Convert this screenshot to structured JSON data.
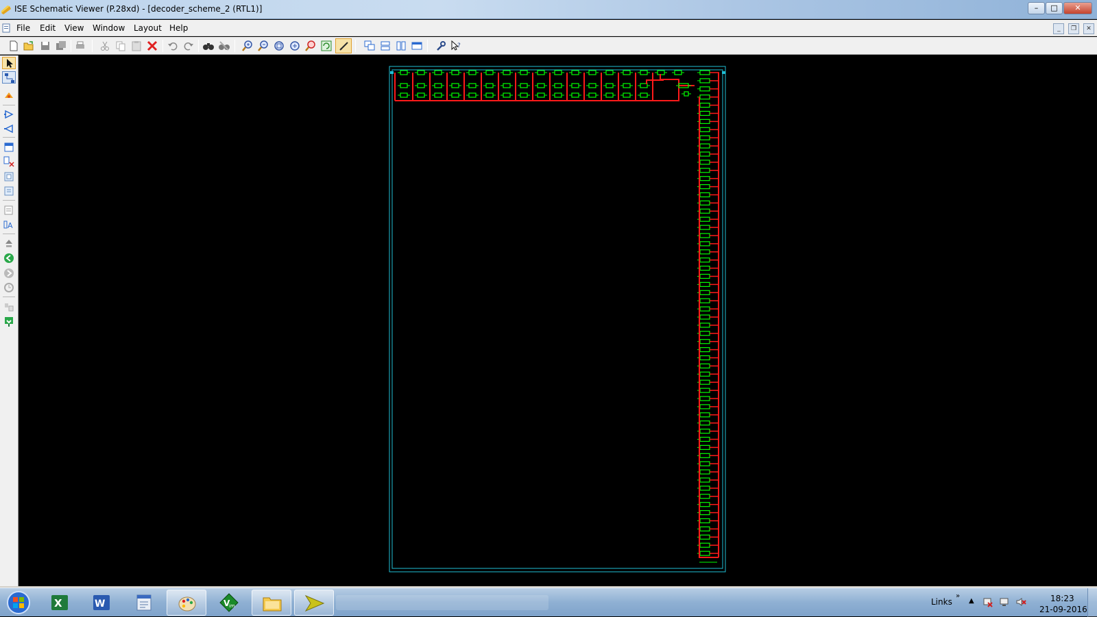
{
  "window": {
    "title": "ISE Schematic Viewer (P.28xd) - [decoder_scheme_2 (RTL1)]"
  },
  "menu": {
    "items": [
      "File",
      "Edit",
      "View",
      "Window",
      "Layout",
      "Help"
    ]
  },
  "toolbar": {
    "icons": [
      "new-icon",
      "open-icon",
      "save-icon",
      "save-all-icon",
      "print-icon",
      "cut-icon",
      "copy-icon",
      "paste-icon",
      "delete-icon",
      "undo-icon",
      "redo-icon",
      "find-icon",
      "find-clear-icon",
      "zoom-in-icon",
      "zoom-out-icon",
      "zoom-full-icon",
      "zoom-area-icon",
      "zoom-selected-icon",
      "refresh-icon",
      "pan-icon",
      "cascade-icon",
      "tile-horizontal-icon",
      "tile-vertical-icon",
      "arrange-icon",
      "settings-icon",
      "help-pointer-icon"
    ]
  },
  "left_toolbar": {
    "icons": [
      "select-icon",
      "hierarchy-icon",
      "highlight-icon",
      "push-into-icon",
      "pop-out-icon",
      "show-instance-icon",
      "remove-instance-icon",
      "expand-icon",
      "collapse-icon",
      "properties-icon",
      "text-icon",
      "up-icon",
      "back-icon",
      "forward-icon",
      "history-icon",
      "info-icon",
      "flag-icon"
    ]
  },
  "schematic": {
    "wire_color": "#ff1a1a",
    "gate_color": "#00ff00",
    "border_color": "#1fbfd6"
  },
  "taskbar": {
    "apps": [
      "excel-icon",
      "word-icon",
      "address-book-icon",
      "paint-icon",
      "vim-icon",
      "file-explorer-icon",
      "xilinx-ise-icon"
    ],
    "links_label": "Links",
    "chevron": "»",
    "time": "18:23",
    "date": "21-09-2016"
  }
}
